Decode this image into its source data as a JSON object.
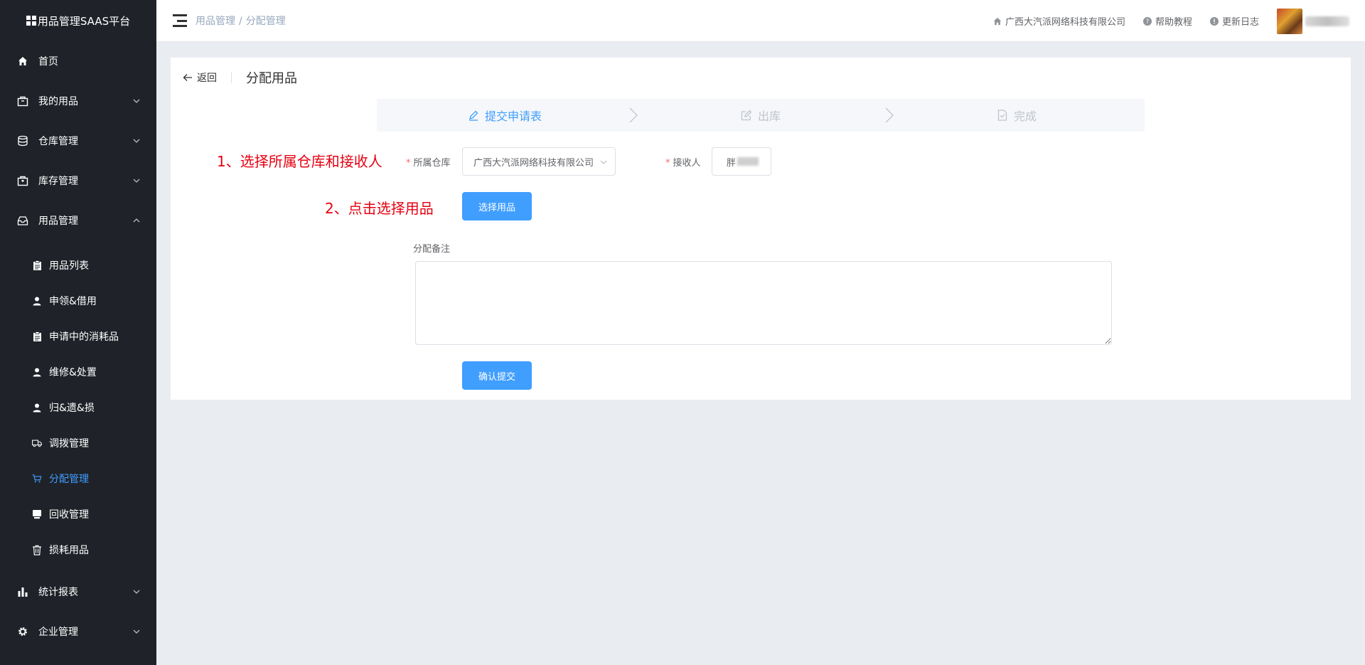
{
  "app": {
    "title": "用品管理SAAS平台"
  },
  "sidebar": {
    "items": [
      {
        "label": "首页",
        "icon": "home-icon"
      },
      {
        "label": "我的用品",
        "icon": "bag-icon"
      },
      {
        "label": "仓库管理",
        "icon": "database-icon"
      },
      {
        "label": "库存管理",
        "icon": "box-icon"
      },
      {
        "label": "用品管理",
        "icon": "inbox-icon"
      },
      {
        "label": "统计报表",
        "icon": "bar-chart-icon"
      },
      {
        "label": "企业管理",
        "icon": "gear-icon"
      }
    ],
    "sub_items": [
      {
        "label": "用品列表",
        "icon": "clipboard-icon"
      },
      {
        "label": "申领&借用",
        "icon": "user-icon"
      },
      {
        "label": "申请中的消耗品",
        "icon": "clipboard-icon"
      },
      {
        "label": "维修&处置",
        "icon": "user-icon"
      },
      {
        "label": "归&遗&损",
        "icon": "user-icon"
      },
      {
        "label": "调拨管理",
        "icon": "truck-icon"
      },
      {
        "label": "分配管理",
        "icon": "cart-icon"
      },
      {
        "label": "回收管理",
        "icon": "monitor-icon"
      },
      {
        "label": "损耗用品",
        "icon": "trash-icon"
      }
    ],
    "active_sub": "分配管理"
  },
  "header": {
    "breadcrumb": [
      "用品管理",
      "分配管理"
    ],
    "breadcrumb_sep": "/",
    "company": "广西大汽派网络科技有限公司",
    "help": "帮助教程",
    "changelog": "更新日志"
  },
  "page": {
    "back_label": "返回",
    "title": "分配用品"
  },
  "steps": [
    {
      "label": "提交申请表",
      "icon": "edit-icon",
      "active": true
    },
    {
      "label": "出库",
      "icon": "edit-square-icon",
      "active": false
    },
    {
      "label": "完成",
      "icon": "document-check-icon",
      "active": false
    }
  ],
  "annotations": {
    "step1": "1、选择所属仓库和接收人",
    "step2": "2、点击选择用品"
  },
  "form": {
    "warehouse_label": "所属仓库",
    "warehouse_value": "广西大汽派网络科技有限公司",
    "receiver_label": "接收人",
    "receiver_value": "胖",
    "required_mark": "*",
    "select_goods_button": "选择用品",
    "remark_label": "分配备注",
    "remark_value": "",
    "submit_button": "确认提交"
  },
  "colors": {
    "sidebar_bg": "#1f2329",
    "primary": "#409eff",
    "annotation": "#e60012",
    "page_bg": "#e9edf2"
  }
}
